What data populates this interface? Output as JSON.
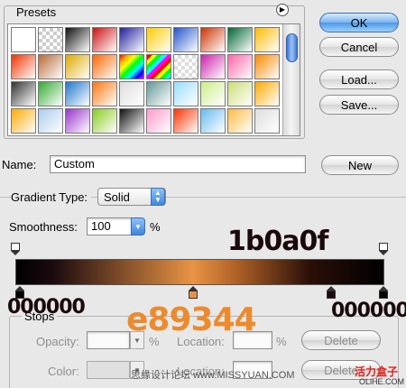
{
  "presets": {
    "label": "Presets",
    "swatches": [
      [
        "#ffffff",
        "checker-grey",
        "#111111",
        "#cc1111",
        "#2020a0",
        "#ffcc00",
        "#2255cc",
        "#cc3300",
        "#006633",
        "#ffbb00"
      ],
      [
        "#ee3300",
        "#b86a3a",
        "#ddaa00",
        "#ff6600",
        "rainbow",
        "rainbow-stripe",
        "checker-light",
        "#cc22aa",
        "#ff66aa",
        "#ff8800"
      ],
      [
        "#333333",
        "#33aa33",
        "#2277cc",
        "#ff7711",
        "#dddddd",
        "#669999",
        "#99ddff",
        "#ccee88",
        "#ccdd77",
        "#ffaa00"
      ],
      [
        "#ffaa00",
        "#aaccee",
        "#9933cc",
        "#88cc22",
        "#111111",
        "#ff99cc",
        "#ff3300",
        "#66bbee",
        "#ffbb44",
        "#dddddd"
      ]
    ]
  },
  "buttons": {
    "ok": "OK",
    "cancel": "Cancel",
    "load": "Load...",
    "save": "Save...",
    "new": "New"
  },
  "name": {
    "label": "Name:",
    "value": "Custom"
  },
  "gradient_type": {
    "label": "Gradient Type:",
    "value": "Solid"
  },
  "smoothness": {
    "label": "Smoothness:",
    "value": "100",
    "unit": "%"
  },
  "annotations": {
    "top_right": "1b0a0f",
    "left_bottom": "000000",
    "center": "e89344",
    "right_bottom": "000000"
  },
  "stops": {
    "label": "Stops",
    "opacity_label": "Opacity:",
    "opacity_unit": "%",
    "location_label": "Location:",
    "location_unit": "%",
    "delete_label": "Delete",
    "color_label": "Color:",
    "location2_label": "Location:",
    "delete2_label": "Delete"
  },
  "watermarks": {
    "left": "思缘设计论坛",
    "url": "www.MISSYUAN.COM",
    "brand": "活力盒子",
    "brand_url": "OLiHE.COM"
  },
  "colors": {
    "accent": "#3e86e0",
    "gradient_start": "#000000",
    "gradient_mid": "#e89344",
    "gradient_dark": "#1b0a0f",
    "annotation_orange": "#ec8b2e",
    "annotation_dark": "#1a0a0a"
  }
}
